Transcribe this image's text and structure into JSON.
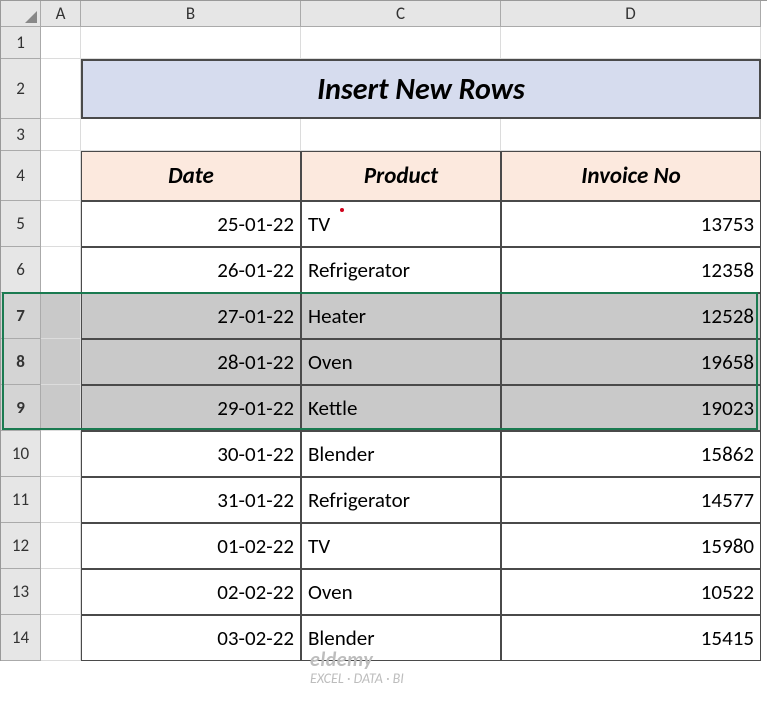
{
  "columns": [
    "",
    "A",
    "B",
    "C",
    "D"
  ],
  "row_headers": [
    "1",
    "2",
    "3",
    "4",
    "5",
    "6",
    "7",
    "8",
    "9",
    "10",
    "11",
    "12",
    "13",
    "14"
  ],
  "selected_rows": [
    "7",
    "8",
    "9"
  ],
  "title": "Insert New Rows",
  "table": {
    "headers": [
      "Date",
      "Product",
      "Invoice No"
    ],
    "rows": [
      {
        "date": "25-01-22",
        "product": "TV",
        "invoice": "13753"
      },
      {
        "date": "26-01-22",
        "product": "Refrigerator",
        "invoice": "12358"
      },
      {
        "date": "27-01-22",
        "product": "Heater",
        "invoice": "12528"
      },
      {
        "date": "28-01-22",
        "product": "Oven",
        "invoice": "19658"
      },
      {
        "date": "29-01-22",
        "product": "Kettle",
        "invoice": "19023"
      },
      {
        "date": "30-01-22",
        "product": "Blender",
        "invoice": "15862"
      },
      {
        "date": "31-01-22",
        "product": "Refrigerator",
        "invoice": "14577"
      },
      {
        "date": "01-02-22",
        "product": "TV",
        "invoice": "15980"
      },
      {
        "date": "02-02-22",
        "product": "Oven",
        "invoice": "10522"
      },
      {
        "date": "03-02-22",
        "product": "Blender",
        "invoice": "15415"
      }
    ]
  },
  "watermark": {
    "brand": "eldemy",
    "tag": "EXCEL · DATA · BI"
  },
  "chart_data": {
    "type": "table",
    "title": "Insert New Rows",
    "columns": [
      "Date",
      "Product",
      "Invoice No"
    ],
    "rows": [
      [
        "25-01-22",
        "TV",
        13753
      ],
      [
        "26-01-22",
        "Refrigerator",
        12358
      ],
      [
        "27-01-22",
        "Heater",
        12528
      ],
      [
        "28-01-22",
        "Oven",
        19658
      ],
      [
        "29-01-22",
        "Kettle",
        19023
      ],
      [
        "30-01-22",
        "Blender",
        15862
      ],
      [
        "31-01-22",
        "Refrigerator",
        14577
      ],
      [
        "01-02-22",
        "TV",
        15980
      ],
      [
        "02-02-22",
        "Oven",
        10522
      ],
      [
        "03-02-22",
        "Blender",
        15415
      ]
    ]
  }
}
